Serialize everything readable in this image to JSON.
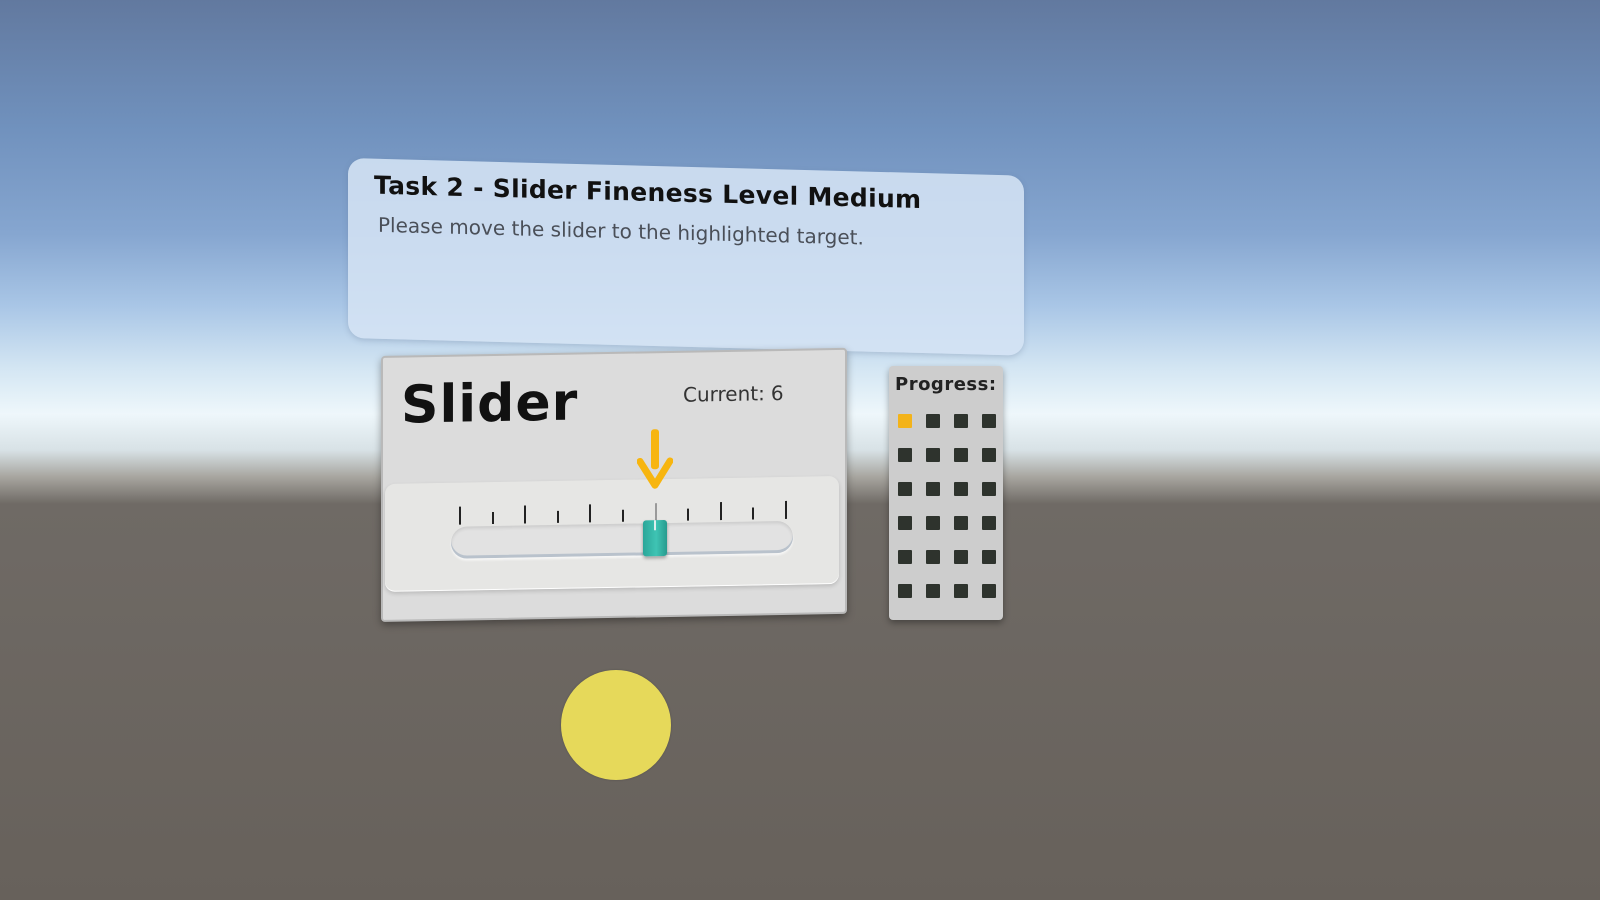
{
  "task": {
    "title": "Task 2 - Slider Fineness Level Medium",
    "instruction": "Please move the slider to the highlighted target."
  },
  "slider": {
    "title": "Slider",
    "current_label": "Current:",
    "current_value": "6",
    "min": 0,
    "max": 10,
    "value": 6,
    "target": 6,
    "tick_count": 11,
    "thumb_color": "#3bb8a9",
    "target_arrow_color": "#f7b50f",
    "target_arrow_icon": "arrow-down-icon"
  },
  "progress": {
    "title": "Progress:",
    "total": 24,
    "current_index": 0,
    "current_color": "#f3b31a",
    "pending_color": "#2e332d"
  },
  "cursor": {
    "color": "#e6d95a"
  }
}
